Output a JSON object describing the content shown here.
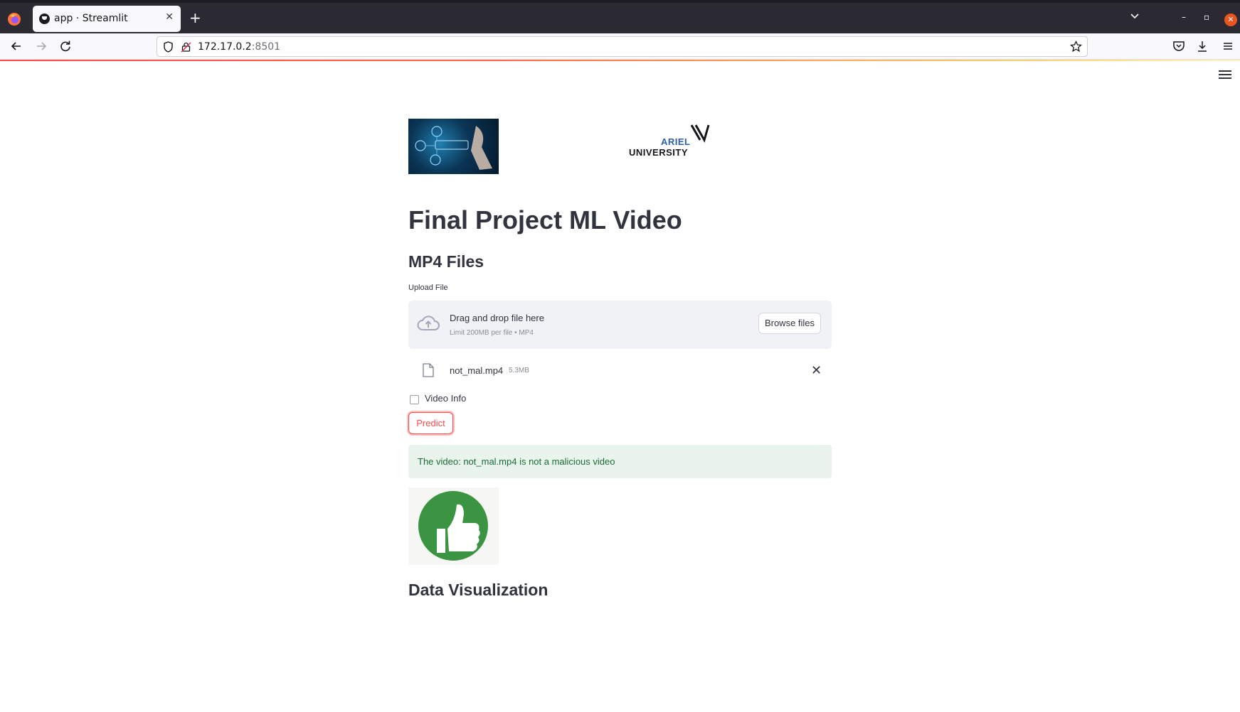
{
  "browser": {
    "tab_title": "app · Streamlit",
    "tab_close": "✕",
    "new_tab": "+",
    "url_host": "172.17.0.2",
    "url_port": ":8501",
    "win_min": "–",
    "win_max": "▫",
    "win_close": "✕"
  },
  "images": {
    "left_image": "cyber-security-banner",
    "right_logo_top": "ARIEL",
    "right_logo_bottom": "UNIVERSITY"
  },
  "page": {
    "title": "Final Project ML Video",
    "section_upload": "MP4 Files",
    "section_viz": "Data Visualization"
  },
  "uploader": {
    "label": "Upload File",
    "drop_title": "Drag and drop file here",
    "drop_subtitle": "Limit 200MB per file • MP4",
    "browse_label": "Browse files",
    "file_name": "not_mal.mp4",
    "file_size": "5.3MB",
    "remove_symbol": "✕"
  },
  "controls": {
    "checkbox_label": "Video Info",
    "checkbox_checked": false,
    "predict_label": "Predict"
  },
  "result": {
    "message": "The video: not_mal.mp4 is not a malicious video",
    "image": "thumbs-up"
  },
  "colors": {
    "accent": "#ff4b4b",
    "success_bg": "#e8f4ec",
    "success_text": "#1b6b3a",
    "thumb_green": "#3a9442"
  }
}
